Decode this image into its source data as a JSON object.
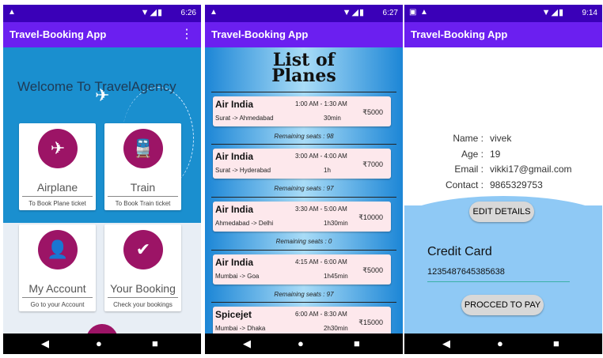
{
  "app_title": "Travel-Booking App",
  "screen1": {
    "status_time": "6:26",
    "welcome": "Welcome To TravelAgency",
    "tiles": [
      {
        "name": "Airplane",
        "sub": "To Book Plane ticket",
        "icon": "✈"
      },
      {
        "name": "Train",
        "sub": "To Book Train ticket",
        "icon": "🚆"
      },
      {
        "name": "My Account",
        "sub": "Go to your Account",
        "icon": "👤"
      },
      {
        "name": "Your Booking",
        "sub": "Check your bookings",
        "icon": "✔"
      }
    ]
  },
  "screen2": {
    "status_time": "6:27",
    "list_title_line1": "List of",
    "list_title_line2": "Planes",
    "flights": [
      {
        "airline": "Air India",
        "times": "1:00 AM - 1:30 AM",
        "route": "Surat -> Ahmedabad",
        "duration": "30min",
        "price": "₹5000",
        "seats": "Remaining seats : 98"
      },
      {
        "airline": "Air India",
        "times": "3:00 AM - 4:00 AM",
        "route": "Surat -> Hyderabad",
        "duration": "1h",
        "price": "₹7000",
        "seats": "Remaining seats : 97"
      },
      {
        "airline": "Air India",
        "times": "3:30 AM - 5:00 AM",
        "route": "Ahmedabad -> Delhi",
        "duration": "1h30min",
        "price": "₹10000",
        "seats": "Remaining seats : 0"
      },
      {
        "airline": "Air India",
        "times": "4:15 AM - 6:00 AM",
        "route": "Mumbai -> Goa",
        "duration": "1h45min",
        "price": "₹5000",
        "seats": "Remaining seats : 97"
      },
      {
        "airline": "Spicejet",
        "times": "6:00 AM - 8:30 AM",
        "route": "Mumbai -> Dhaka",
        "duration": "2h30min",
        "price": "₹15000",
        "seats": ""
      }
    ]
  },
  "screen3": {
    "status_time": "9:14",
    "profile": [
      {
        "label": "Name :",
        "value": "vivek"
      },
      {
        "label": "Age :",
        "value": "19"
      },
      {
        "label": "Email :",
        "value": "vikki17@gmail.com"
      },
      {
        "label": "Contact :",
        "value": "9865329753"
      }
    ],
    "edit_button": "EDIT DETAILS",
    "credit_label": "Credit Card",
    "credit_value": "1235487645385638",
    "pay_button": "PROCCED TO PAY"
  },
  "colors": {
    "status_bar": "#3a00b8",
    "app_bar": "#6b1ff0",
    "tile_icon": "#9c1466"
  }
}
